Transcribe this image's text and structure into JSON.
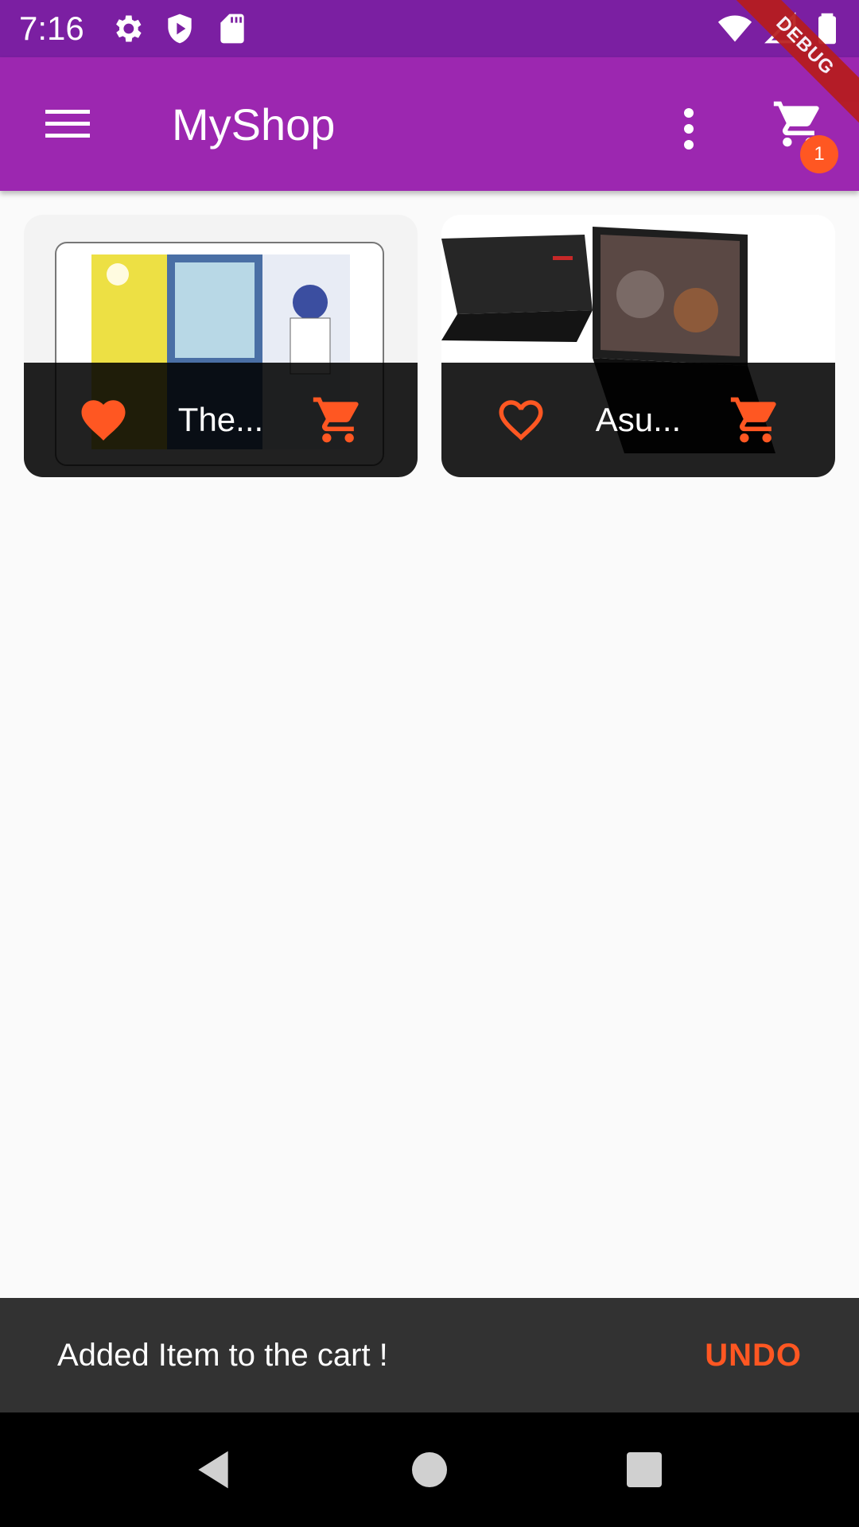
{
  "status_bar": {
    "time": "7:16",
    "icons": [
      "settings-icon",
      "play-protect-icon",
      "sd-card-icon",
      "wifi-icon",
      "signal-icon",
      "battery-icon"
    ]
  },
  "app_bar": {
    "title": "MyShop",
    "cart_badge": "1",
    "background": "#9c27b0",
    "status_background": "#7b1fa2"
  },
  "debug_banner": "DEBUG",
  "products": [
    {
      "title": "The...",
      "favorite": true,
      "image": "tablet-comic-image"
    },
    {
      "title": "Asu...",
      "favorite": false,
      "image": "laptop-image"
    }
  ],
  "snackbar": {
    "message": "Added Item to the cart !",
    "action": "UNDO"
  },
  "colors": {
    "accent": "#ff5722"
  }
}
